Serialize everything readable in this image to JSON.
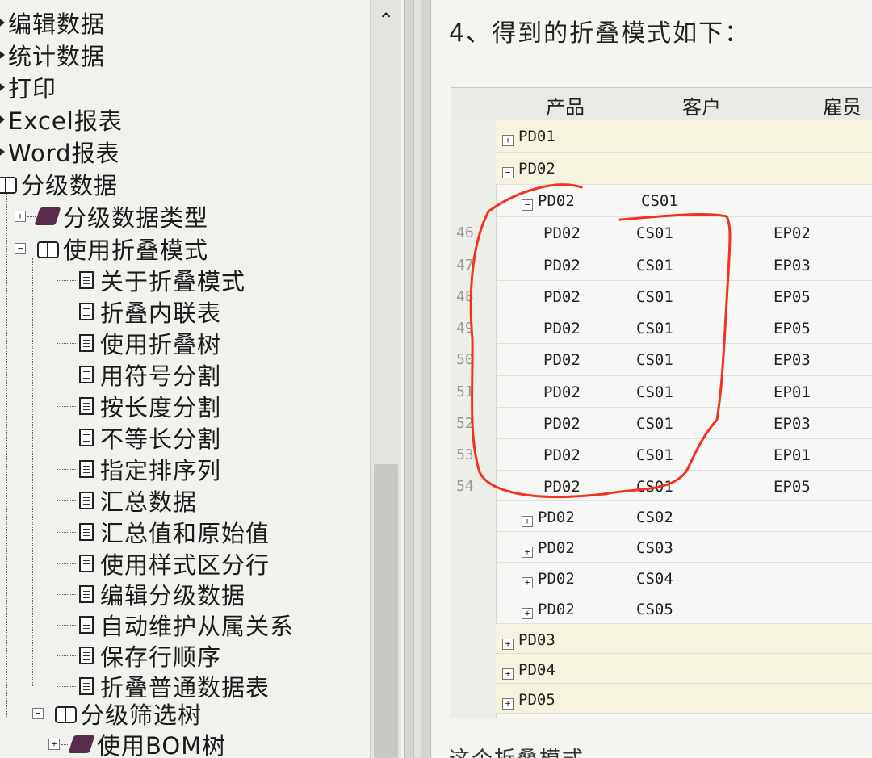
{
  "tree": {
    "items": [
      {
        "label": "编辑数据",
        "icon": "bullet-icon",
        "kind": "leaf-top"
      },
      {
        "label": "统计数据",
        "icon": "bullet-icon",
        "kind": "leaf-top"
      },
      {
        "label": "打印",
        "icon": "bullet-icon",
        "kind": "leaf-top"
      },
      {
        "label": "Excel报表",
        "icon": "bullet-icon",
        "kind": "leaf-top"
      },
      {
        "label": "Word报表",
        "icon": "bullet-icon",
        "kind": "leaf-top"
      },
      {
        "label": "分级数据",
        "icon": "book-open-icon",
        "kind": "top"
      },
      {
        "label": "分级数据类型",
        "icon": "book-closed-icon",
        "kind": "sub"
      },
      {
        "label": "使用折叠模式",
        "icon": "book-open-icon",
        "kind": "sub"
      },
      {
        "label": "关于折叠模式",
        "icon": "document-icon",
        "kind": "doc"
      },
      {
        "label": "折叠内联表",
        "icon": "document-icon",
        "kind": "doc"
      },
      {
        "label": "使用折叠树",
        "icon": "document-icon",
        "kind": "doc"
      },
      {
        "label": "用符号分割",
        "icon": "document-icon",
        "kind": "doc"
      },
      {
        "label": "按长度分割",
        "icon": "document-icon",
        "kind": "doc"
      },
      {
        "label": "不等长分割",
        "icon": "document-icon",
        "kind": "doc"
      },
      {
        "label": "指定排序列",
        "icon": "document-icon",
        "kind": "doc"
      },
      {
        "label": "汇总数据",
        "icon": "document-icon",
        "kind": "doc"
      },
      {
        "label": "汇总值和原始值",
        "icon": "document-icon",
        "kind": "doc"
      },
      {
        "label": "使用样式区分行",
        "icon": "document-icon",
        "kind": "doc"
      },
      {
        "label": "编辑分级数据",
        "icon": "document-icon",
        "kind": "doc"
      },
      {
        "label": "自动维护从属关系",
        "icon": "document-icon",
        "kind": "doc"
      },
      {
        "label": "保存行顺序",
        "icon": "document-icon",
        "kind": "doc"
      },
      {
        "label": "折叠普通数据表",
        "icon": "document-icon",
        "kind": "doc"
      },
      {
        "label": "分级筛选树",
        "icon": "book-open-icon",
        "kind": "sub2"
      },
      {
        "label": "使用BOM树",
        "icon": "book-closed-icon",
        "kind": "sub3"
      }
    ]
  },
  "content": {
    "heading": "4、得到的折叠模式如下：",
    "grid": {
      "columns": [
        "产品",
        "客户",
        "雇员"
      ],
      "rows": [
        {
          "num": "",
          "level": 0,
          "expander": "+",
          "product": "PD01",
          "customer": "",
          "employee": ""
        },
        {
          "num": "",
          "level": 0,
          "expander": "−",
          "product": "PD02",
          "customer": "",
          "employee": ""
        },
        {
          "num": "",
          "level": 1,
          "expander": "−",
          "product": "PD02",
          "customer": "CS01",
          "employee": ""
        },
        {
          "num": "46",
          "level": 2,
          "expander": "",
          "product": "PD02",
          "customer": "CS01",
          "employee": "EP02"
        },
        {
          "num": "47",
          "level": 2,
          "expander": "",
          "product": "PD02",
          "customer": "CS01",
          "employee": "EP03"
        },
        {
          "num": "48",
          "level": 2,
          "expander": "",
          "product": "PD02",
          "customer": "CS01",
          "employee": "EP05"
        },
        {
          "num": "49",
          "level": 2,
          "expander": "",
          "product": "PD02",
          "customer": "CS01",
          "employee": "EP05"
        },
        {
          "num": "50",
          "level": 2,
          "expander": "",
          "product": "PD02",
          "customer": "CS01",
          "employee": "EP03"
        },
        {
          "num": "51",
          "level": 2,
          "expander": "",
          "product": "PD02",
          "customer": "CS01",
          "employee": "EP01"
        },
        {
          "num": "52",
          "level": 2,
          "expander": "",
          "product": "PD02",
          "customer": "CS01",
          "employee": "EP03"
        },
        {
          "num": "53",
          "level": 2,
          "expander": "",
          "product": "PD02",
          "customer": "CS01",
          "employee": "EP01"
        },
        {
          "num": "54",
          "level": 2,
          "expander": "",
          "product": "PD02",
          "customer": "CS01",
          "employee": "EP05"
        },
        {
          "num": "",
          "level": 1,
          "expander": "+",
          "product": "PD02",
          "customer": "CS02",
          "employee": ""
        },
        {
          "num": "",
          "level": 1,
          "expander": "+",
          "product": "PD02",
          "customer": "CS03",
          "employee": ""
        },
        {
          "num": "",
          "level": 1,
          "expander": "+",
          "product": "PD02",
          "customer": "CS04",
          "employee": ""
        },
        {
          "num": "",
          "level": 1,
          "expander": "+",
          "product": "PD02",
          "customer": "CS05",
          "employee": ""
        },
        {
          "num": "",
          "level": 0,
          "expander": "+",
          "product": "PD03",
          "customer": "",
          "employee": ""
        },
        {
          "num": "",
          "level": 0,
          "expander": "+",
          "product": "PD04",
          "customer": "",
          "employee": ""
        },
        {
          "num": "",
          "level": 0,
          "expander": "+",
          "product": "PD05",
          "customer": "",
          "employee": ""
        }
      ]
    },
    "bottom_text": "这个折叠模式"
  },
  "colors": {
    "annotation": "#f0321e",
    "group_band": "#f6f4de"
  }
}
